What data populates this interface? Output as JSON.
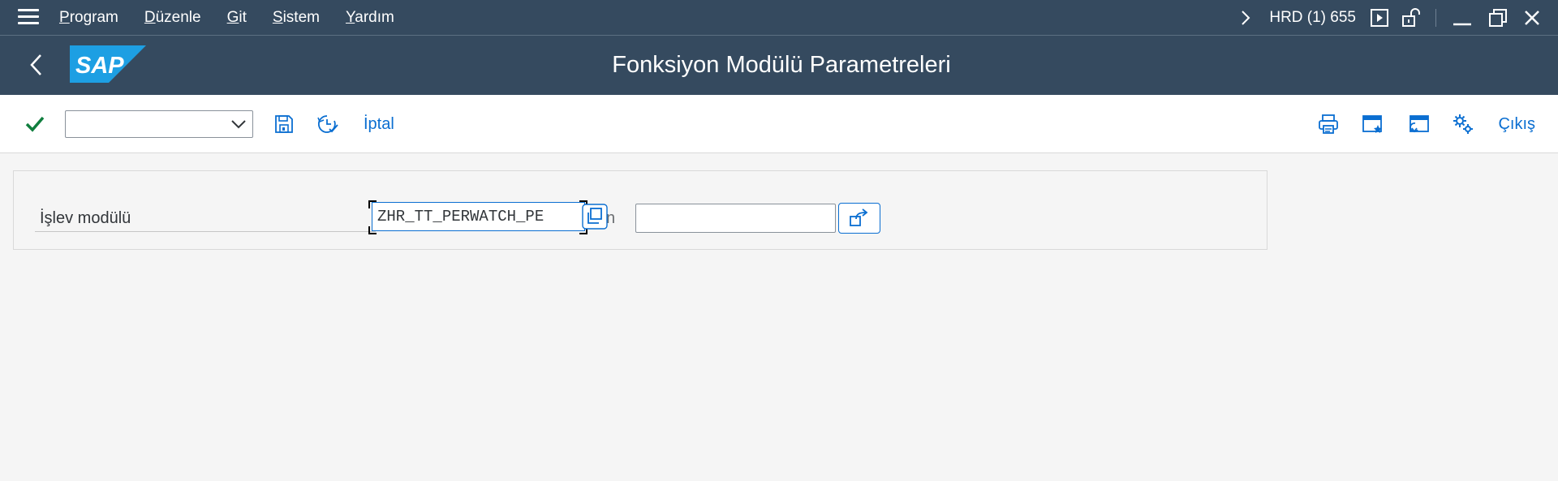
{
  "menubar": {
    "items": [
      {
        "first": "P",
        "rest": "rogram"
      },
      {
        "first": "D",
        "rest": "üzenle"
      },
      {
        "first": "G",
        "rest": "it"
      },
      {
        "first": "S",
        "rest": "istem"
      },
      {
        "first": "Y",
        "rest": "ardım"
      }
    ],
    "system_info": "HRD (1) 655"
  },
  "header": {
    "title": "Fonksiyon Modülü Parametreleri",
    "logo_text": "SAP",
    "logo_color": "#1d9fe3"
  },
  "toolbar": {
    "dropdown_value": "",
    "cancel_label": "İptal",
    "exit_label": "Çıkış"
  },
  "form": {
    "function_module_label": "İşlev modülü",
    "function_module_value": "ZHR_TT_PERWATCH_PE",
    "truncated_label": "n",
    "second_value": ""
  },
  "colors": {
    "shell": "#354a5f",
    "accent": "#0a6ed1",
    "confirm_green": "#107e3e"
  }
}
